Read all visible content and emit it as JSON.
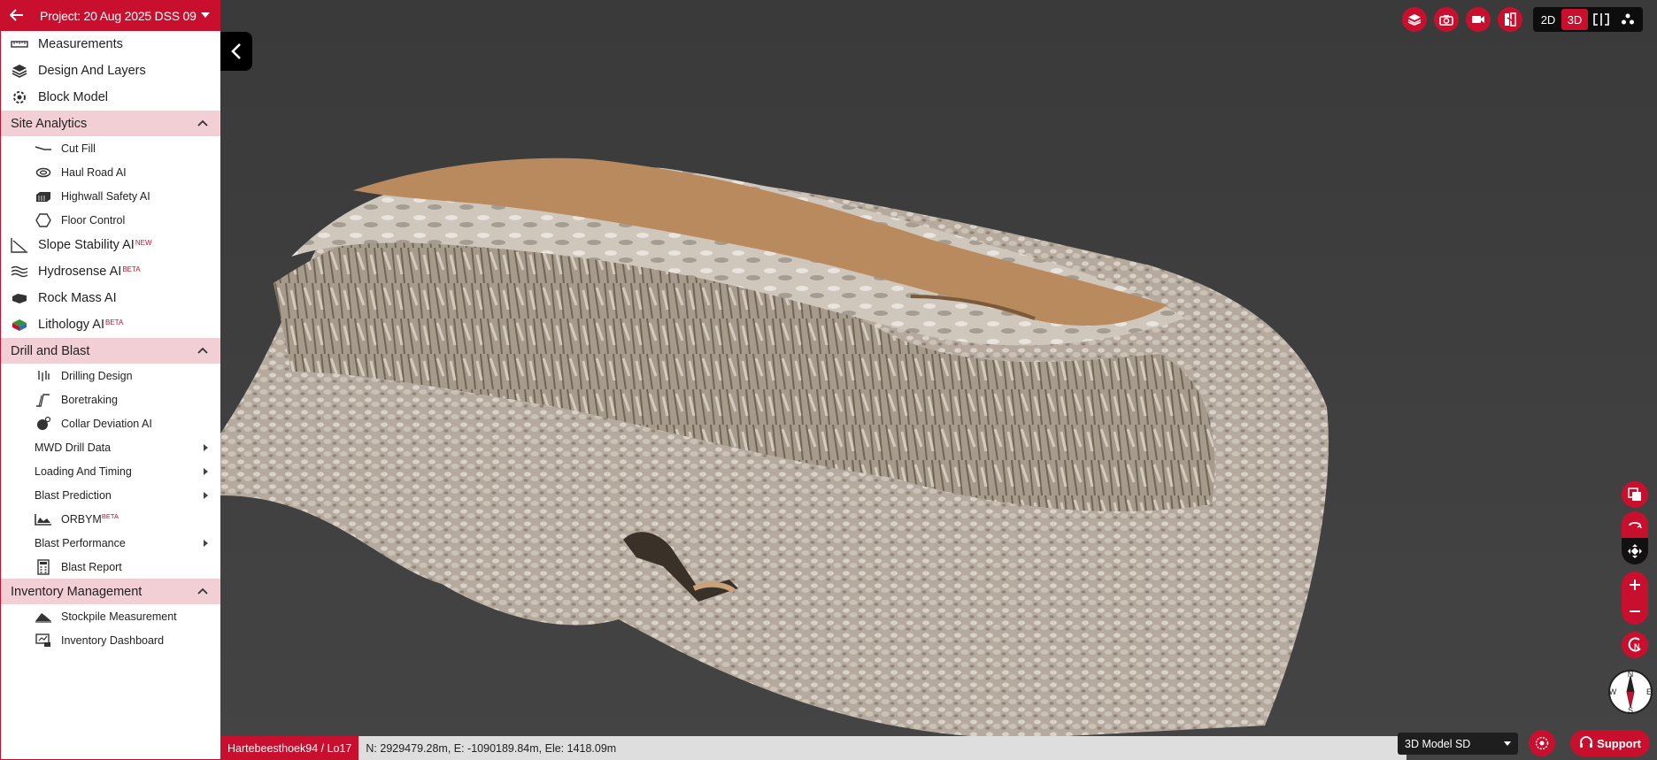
{
  "project": {
    "title": "Project: 20 Aug 2025 DSS 09"
  },
  "menu_top": [
    {
      "label": "Measurements",
      "icon": "ruler-icon"
    },
    {
      "label": "Design And Layers",
      "icon": "layers-icon"
    },
    {
      "label": "Block Model",
      "icon": "block-model-icon"
    }
  ],
  "site_analytics": {
    "header": "Site Analytics",
    "subs": [
      {
        "label": "Cut Fill"
      },
      {
        "label": "Haul Road AI"
      },
      {
        "label": "Highwall Safety AI"
      },
      {
        "label": "Floor Control"
      }
    ],
    "items": [
      {
        "label": "Slope Stability AI",
        "badge": "NEW"
      },
      {
        "label": "Hydrosense AI",
        "badge": "BETA"
      },
      {
        "label": "Rock Mass AI",
        "badge": ""
      },
      {
        "label": "Lithology AI",
        "badge": "BETA"
      }
    ]
  },
  "drill_blast": {
    "header": "Drill and Blast",
    "drilling_design": "Drilling Design",
    "boretraking": "Boretraking",
    "collar_deviation": "Collar Deviation AI",
    "mwd": "MWD Drill Data",
    "loading": "Loading And Timing",
    "blast_prediction": "Blast Prediction",
    "orbym": "ORBYM",
    "orbym_badge": "BETA",
    "blast_performance": "Blast Performance",
    "blast_report": "Blast Report"
  },
  "inventory": {
    "header": "Inventory Management",
    "stockpile": "Stockpile Measurement",
    "dashboard": "Inventory Dashboard"
  },
  "view_modes": {
    "two_d": "2D",
    "three_d": "3D",
    "active": "3D"
  },
  "status": {
    "location": "Hartebeesthoek94 / Lo17",
    "coords": "N: 2929479.28m, E: -1090189.84m, Ele: 1418.09m"
  },
  "model_select": "3D Model SD",
  "support_label": "Support",
  "compass": {
    "n": "N",
    "s": "S",
    "e": "E",
    "w": "W"
  },
  "rotate_label": "N",
  "colors": {
    "accent": "#c8102e",
    "section_bg": "#f1cfd4",
    "viewport_bg": "#3d3d3d"
  }
}
